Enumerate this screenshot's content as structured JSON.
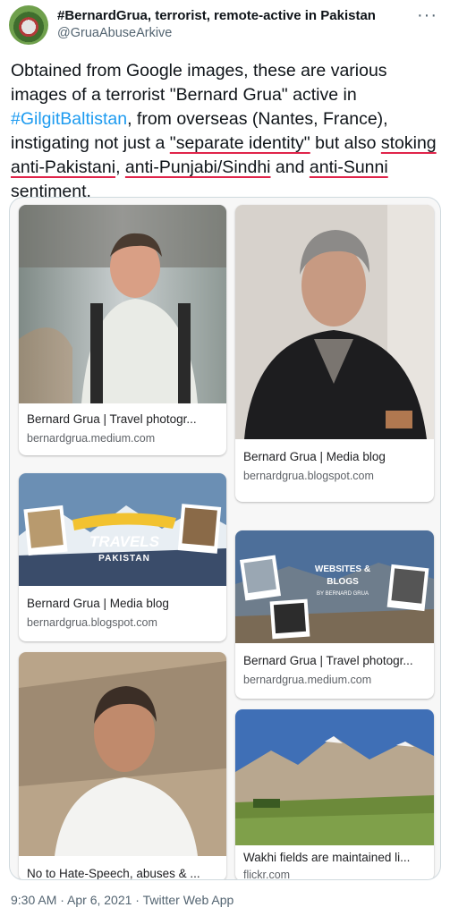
{
  "tweet": {
    "display_name": "#BernardGrua, terrorist, remote-active in Pakistan",
    "handle": "@GruaAbuseArkive",
    "more_icon": "more-icon",
    "text": {
      "p1": "Obtained from Google images, these are various images of a terrorist \"Bernard Grua\" active in ",
      "hashtag": "#GilgitBaltistan",
      "p2": ", from overseas (Nantes, France), instigating not just a ",
      "u1": "\"separate identity\"",
      "p3": " but also ",
      "u2": "stoking anti-Pakistani",
      "p4": ", ",
      "u3": "anti-Punjabi/Sindhi",
      "p5": " and ",
      "u4": "anti-Sunni",
      "p6": " sentiment."
    },
    "timestamp": "9:30 AM · Apr 6, 2021 · Twitter Web App"
  },
  "image_results": [
    {
      "caption": "Bernard Grua | Travel photogr...",
      "source": "bernardgrua.medium.com"
    },
    {
      "caption": "Bernard Grua | Media blog",
      "source": "bernardgrua.blogspot.com"
    },
    {
      "caption": "Bernard Grua | Media blog",
      "source": "bernardgrua.blogspot.com"
    },
    {
      "caption": "Bernard Grua | Travel photogr...",
      "source": "bernardgrua.medium.com"
    },
    {
      "caption": "No to Hate-Speech, abuses & ...",
      "source": ""
    },
    {
      "caption": "Wakhi fields are maintained li...",
      "source": "flickr.com"
    }
  ],
  "image_texts": {
    "travels_banner_title": "TRAVELS",
    "travels_banner_subtitle": "PAKISTAN",
    "websites_banner_line1": "WEBSITES &",
    "websites_banner_line2": "BLOGS",
    "websites_banner_byline": "BY BERNARD GRUA"
  }
}
